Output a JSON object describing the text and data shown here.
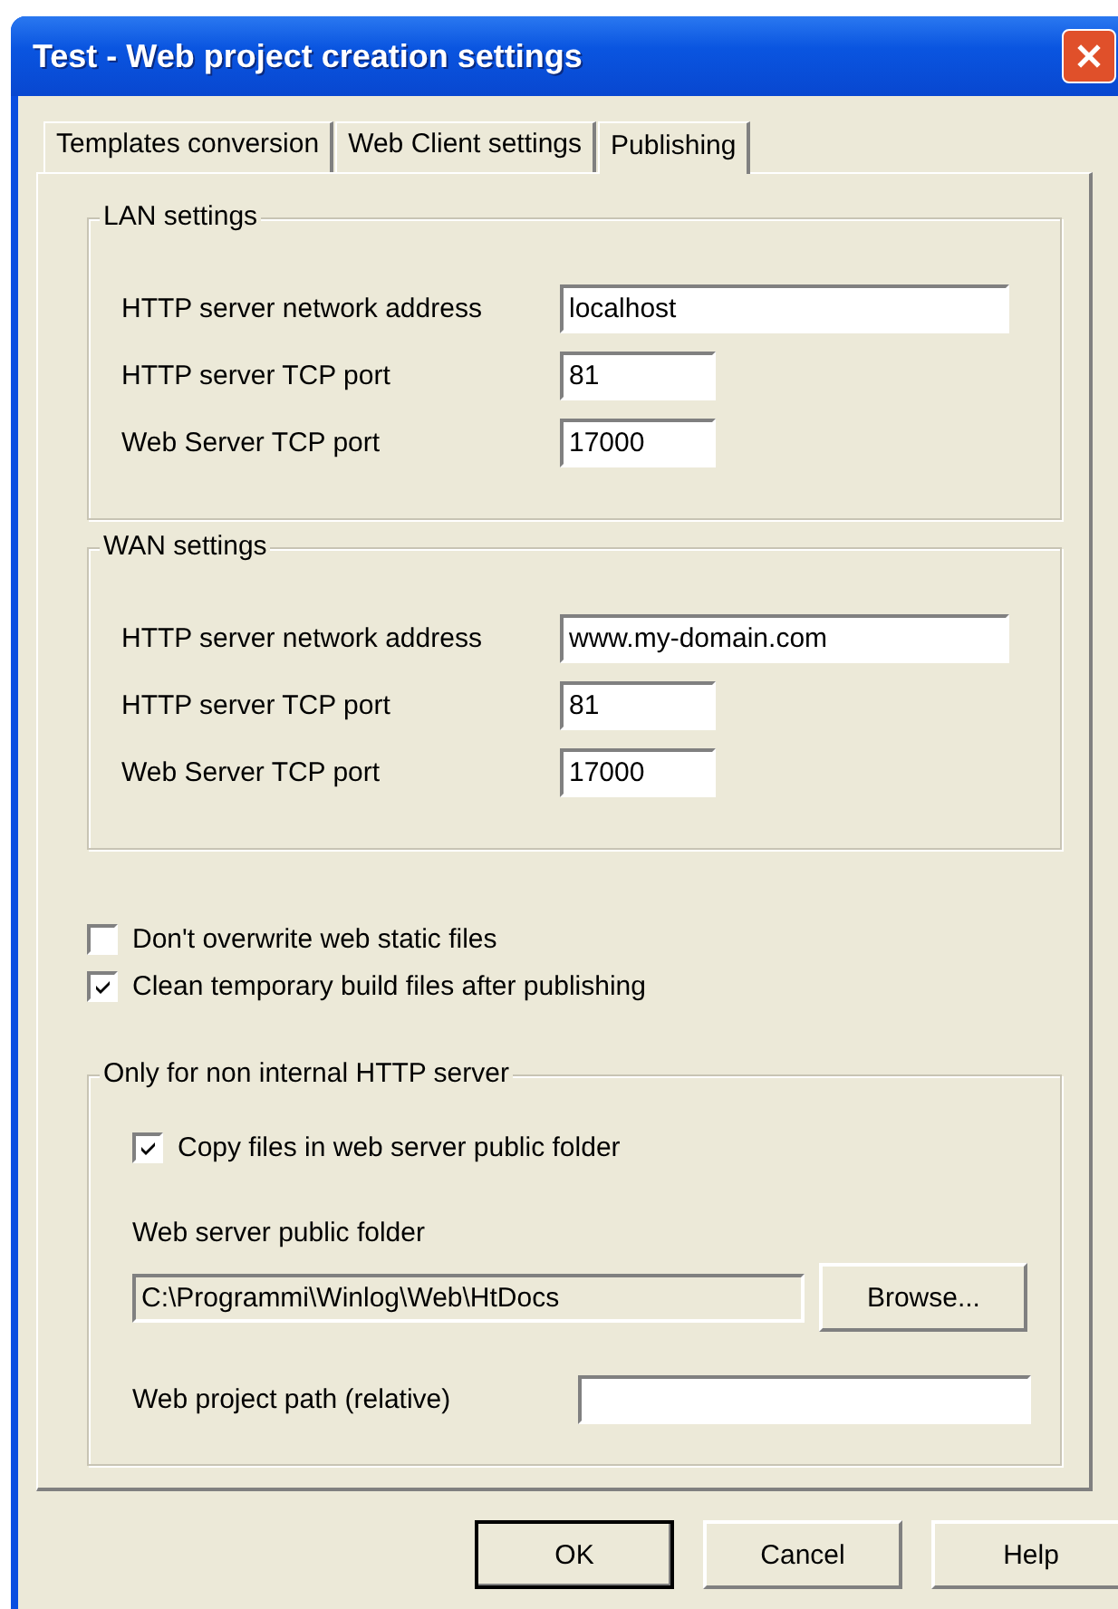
{
  "window": {
    "title": "Test - Web project creation settings"
  },
  "tabs": [
    {
      "label": "Templates conversion",
      "selected": false
    },
    {
      "label": "Web Client settings",
      "selected": false
    },
    {
      "label": "Publishing",
      "selected": true
    }
  ],
  "lan_settings": {
    "title": "LAN settings",
    "fields": [
      {
        "label": "HTTP server network address",
        "value": "localhost",
        "kind": "wide"
      },
      {
        "label": "HTTP server TCP port",
        "value": "81",
        "kind": "short"
      },
      {
        "label": "Web Server TCP port",
        "value": "17000",
        "kind": "short"
      }
    ]
  },
  "wan_settings": {
    "title": "WAN settings",
    "fields": [
      {
        "label": "HTTP server network address",
        "value": "www.my-domain.com",
        "kind": "wide"
      },
      {
        "label": "HTTP server TCP port",
        "value": "81",
        "kind": "short"
      },
      {
        "label": "Web Server TCP port",
        "value": "17000",
        "kind": "short"
      }
    ]
  },
  "options": [
    {
      "label": "Don't overwrite web static files",
      "checked": false
    },
    {
      "label": "Clean temporary build files after publishing",
      "checked": true
    }
  ],
  "external_server": {
    "title": "Only for non internal HTTP server",
    "copy_files": {
      "label": "Copy files in web server public folder",
      "checked": true
    },
    "folder_label": "Web server public folder",
    "folder_value": "C:\\Programmi\\Winlog\\Web\\HtDocs",
    "browse_button": "Browse...",
    "project_path_label": "Web project path (relative)"
  },
  "buttons": [
    {
      "label": "OK",
      "default": true
    },
    {
      "label": "Cancel",
      "default": false
    },
    {
      "label": "Help",
      "default": false
    }
  ]
}
